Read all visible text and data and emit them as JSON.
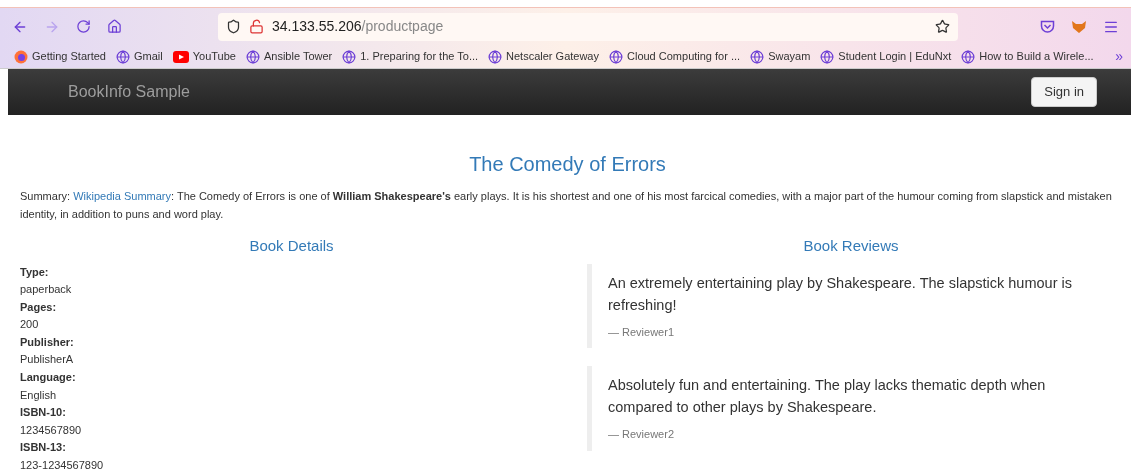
{
  "browser": {
    "address_host": "34.133.55.206",
    "address_path": "/productpage",
    "bookmarks": [
      {
        "kind": "firefox",
        "label": "Getting Started"
      },
      {
        "kind": "globe",
        "label": "Gmail"
      },
      {
        "kind": "youtube",
        "label": "YouTube"
      },
      {
        "kind": "globe",
        "label": "Ansible Tower"
      },
      {
        "kind": "globe",
        "label": "1. Preparing for the To..."
      },
      {
        "kind": "globe",
        "label": "Netscaler Gateway"
      },
      {
        "kind": "globe",
        "label": "Cloud Computing for ..."
      },
      {
        "kind": "globe",
        "label": "Swayam"
      },
      {
        "kind": "globe",
        "label": "Student Login | EduNxt"
      },
      {
        "kind": "globe",
        "label": "How to Build a Wirele..."
      }
    ],
    "overflow": "»"
  },
  "navbar": {
    "brand": "BookInfo Sample",
    "button": "Sign in"
  },
  "title": "The Comedy of Errors",
  "summary": {
    "prefix": "Summary: ",
    "link": "Wikipedia Summary",
    "text": ": The Comedy of Errors is one of **William Shakespeare's** early plays. It is his shortest and one of his most farcical comedies, with a major part of the humour coming from slapstick and mistaken identity, in addition to puns and word play."
  },
  "details": {
    "heading": "Book Details",
    "fields": [
      {
        "label": "Type:",
        "value": "paperback"
      },
      {
        "label": "Pages:",
        "value": "200"
      },
      {
        "label": "Publisher:",
        "value": "PublisherA"
      },
      {
        "label": "Language:",
        "value": "English"
      },
      {
        "label": "ISBN-10:",
        "value": "1234567890"
      },
      {
        "label": "ISBN-13:",
        "value": "123-1234567890"
      }
    ]
  },
  "reviews": {
    "heading": "Book Reviews",
    "items": [
      {
        "text": "An extremely entertaining play by Shakespeare. The slapstick humour is refreshing!",
        "reviewer": "— Reviewer1"
      },
      {
        "text": "Absolutely fun and entertaining. The play lacks thematic depth when compared to other plays by Shakespeare.",
        "reviewer": "— Reviewer2"
      }
    ]
  }
}
